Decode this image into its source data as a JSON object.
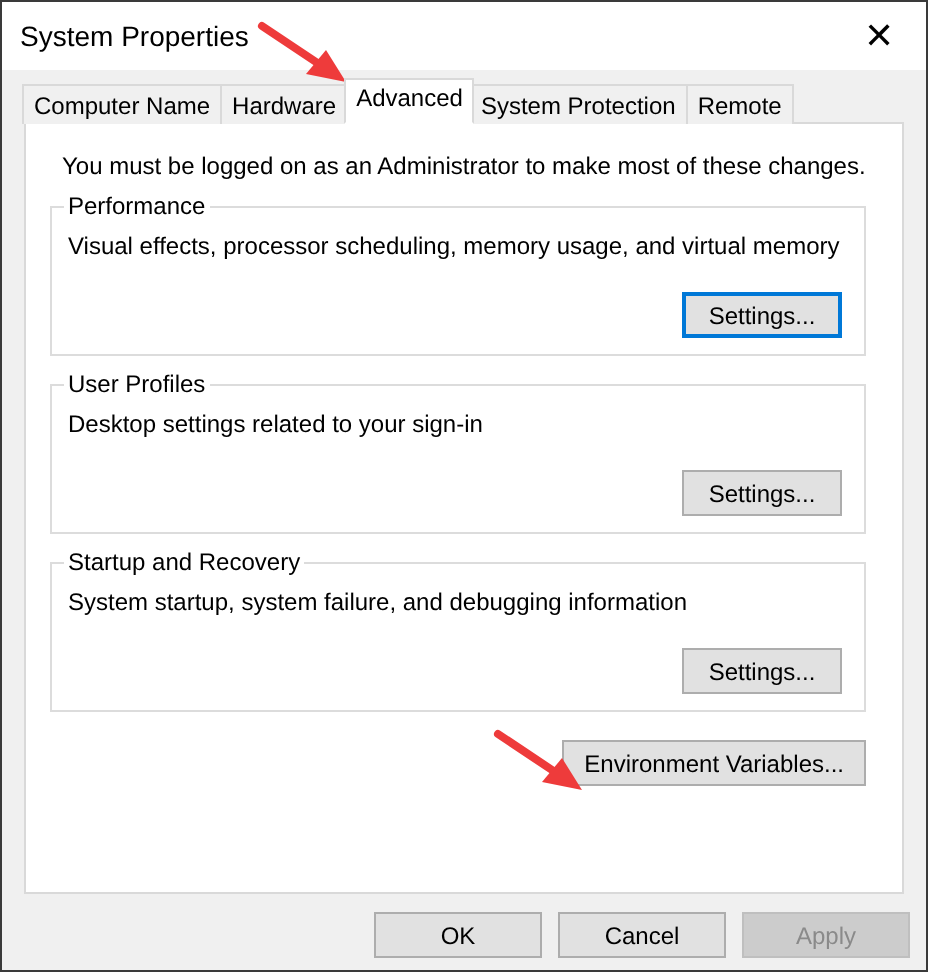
{
  "window": {
    "title": "System Properties",
    "close": "✕"
  },
  "tabs": [
    {
      "label": "Computer Name",
      "selected": false
    },
    {
      "label": "Hardware",
      "selected": false
    },
    {
      "label": "Advanced",
      "selected": true
    },
    {
      "label": "System Protection",
      "selected": false
    },
    {
      "label": "Remote",
      "selected": false
    }
  ],
  "notice": "You must be logged on as an Administrator to make most of these changes.",
  "groups": [
    {
      "title": "Performance",
      "description": "Visual effects, processor scheduling, memory usage, and virtual memory",
      "button": {
        "label": "Settings...",
        "focused": true
      }
    },
    {
      "title": "User Profiles",
      "description": "Desktop settings related to your sign-in",
      "button": {
        "label": "Settings...",
        "focused": false
      }
    },
    {
      "title": "Startup and Recovery",
      "description": "System startup, system failure, and debugging information",
      "button": {
        "label": "Settings...",
        "focused": false
      }
    }
  ],
  "environment_button": {
    "label": "Environment Variables...",
    "focused": false
  },
  "buttons": [
    {
      "label": "OK",
      "disabled": false
    },
    {
      "label": "Cancel",
      "disabled": false
    },
    {
      "label": "Apply",
      "disabled": true
    }
  ]
}
